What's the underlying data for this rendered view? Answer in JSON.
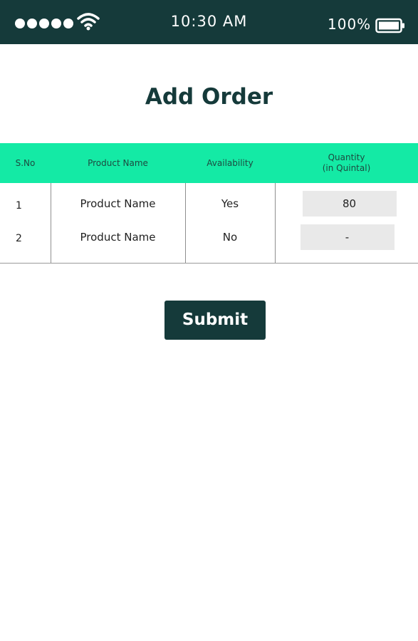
{
  "status_bar": {
    "signal_dots": 5,
    "time": "10:30 AM",
    "battery_percent": "100%"
  },
  "page": {
    "title": "Add Order"
  },
  "table": {
    "headers": {
      "sno": "S.No",
      "product": "Product Name",
      "availability": "Availability",
      "quantity_line1": "Quantity",
      "quantity_line2": "(in Quintal)"
    },
    "rows": [
      {
        "sno": "1",
        "product": "Product Name",
        "availability": "Yes",
        "quantity": "80"
      },
      {
        "sno": "2",
        "product": "Product Name",
        "availability": "No",
        "quantity": "-"
      }
    ]
  },
  "actions": {
    "submit_label": "Submit"
  },
  "colors": {
    "brand_dark": "#153a3a",
    "header_accent": "#14eaa5",
    "input_bg": "#e9e9e9"
  }
}
